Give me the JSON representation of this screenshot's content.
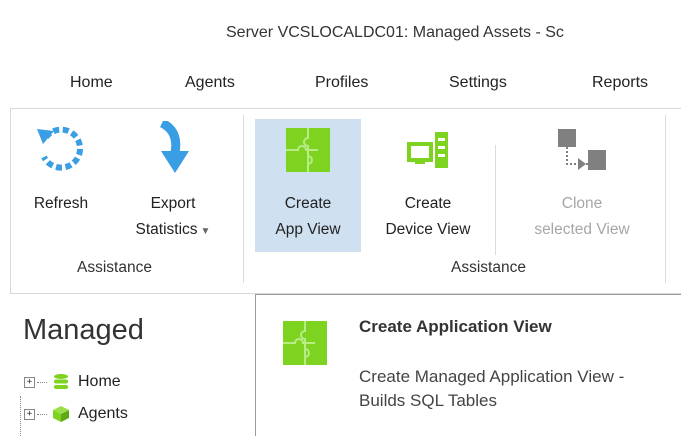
{
  "window": {
    "title": "Server VCSLOCALDC01: Managed Assets - Sc"
  },
  "menu": {
    "items": [
      {
        "label": "Home"
      },
      {
        "label": "Agents"
      },
      {
        "label": "Profiles"
      },
      {
        "label": "Settings"
      },
      {
        "label": "Reports"
      }
    ]
  },
  "ribbon": {
    "buttons": {
      "refresh": {
        "label": "Refresh",
        "icon": "refresh-icon"
      },
      "export": {
        "label1": "Export",
        "label2": "Statistics",
        "icon": "export-arrow-icon"
      },
      "create_app_view": {
        "label1": "Create",
        "label2": "App View",
        "icon": "puzzle-icon"
      },
      "create_device_view": {
        "label1": "Create",
        "label2": "Device View",
        "icon": "device-icon"
      },
      "clone_view": {
        "label1": "Clone",
        "label2": "selected View",
        "icon": "clone-icon"
      }
    },
    "groups": [
      {
        "label": "Assistance"
      },
      {
        "label": "Assistance"
      }
    ]
  },
  "sidebar": {
    "title": "Managed",
    "tree": [
      {
        "label": "Home",
        "icon": "database-icon"
      },
      {
        "label": "Agents",
        "icon": "cube-icon"
      }
    ]
  },
  "tooltip": {
    "title": "Create Application View",
    "description": "Create Managed Application View - Builds SQL Tables",
    "icon": "puzzle-icon"
  },
  "colors": {
    "selected_bg": "#cfe0f1",
    "icon_blue": "#3a9ee4",
    "icon_green": "#7ed321",
    "icon_gray": "#808080",
    "disabled_text": "#a6a6a6"
  }
}
